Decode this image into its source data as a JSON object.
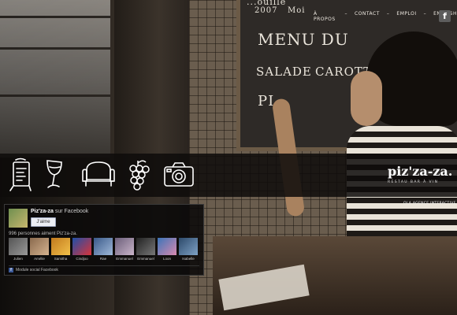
{
  "nav": {
    "items": [
      "À PROPOS",
      "CONTACT",
      "EMPLOI",
      "ENGLISH"
    ]
  },
  "social": {
    "facebook_glyph": "f"
  },
  "chalkboard": {
    "line1": "...ouille",
    "line2": "2007",
    "line3": "Moi",
    "line4": "MENU DU",
    "line5": "SALADE",
    "line6": "CAROTTE",
    "line7": "PI"
  },
  "icons": [
    "menu-board-icon",
    "wine-glass-icon",
    "armchair-icon",
    "grapes-icon",
    "camera-icon"
  ],
  "brand": {
    "logo": "piz'za-za.",
    "tagline": "RESTAU   BAR À VIN"
  },
  "agency": "OLA AGENCE INTERACTIVE",
  "facebook_widget": {
    "page_name": "Piz'za-za",
    "page_suffix": "sur Facebook",
    "like_label": "J'aime",
    "count_text": "996 personnes aiment Piz'za-za.",
    "people": [
      "Julien",
      "Amélie",
      "Samitha",
      "Cindjoo",
      "Rae",
      "Emmanuel",
      "Emmanuel",
      "Loon",
      "Isabelle"
    ],
    "footer": "Module social Facebook"
  },
  "colors": {
    "band": "#0e0c0b",
    "facebook_blue": "#3b5998",
    "chalk": "#e9e4da"
  }
}
